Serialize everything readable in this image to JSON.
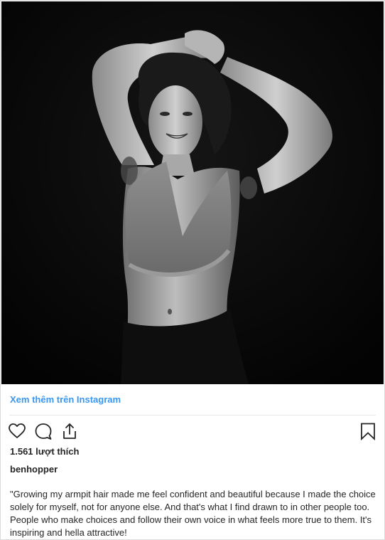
{
  "post": {
    "photo_description_icon": "portrait-photo",
    "view_more_label": "Xem thêm trên Instagram",
    "likes_text": "1.561 lượt thích",
    "username": "benhopper",
    "caption": "\"Growing my armpit hair made me feel confident and beautiful because I made the choice solely for myself, not for anyone else. And that's what I find drawn to in other people too. People who make choices and follow their own voice in what feels more true to them. It's inspiring and hella attractive!"
  },
  "icons": {
    "like": "heart-outline-icon",
    "comment": "comment-bubble-icon",
    "share": "share-upload-icon",
    "save": "bookmark-icon"
  },
  "colors": {
    "link": "#3897f0",
    "text": "#262626",
    "photo_background": "#060606"
  }
}
